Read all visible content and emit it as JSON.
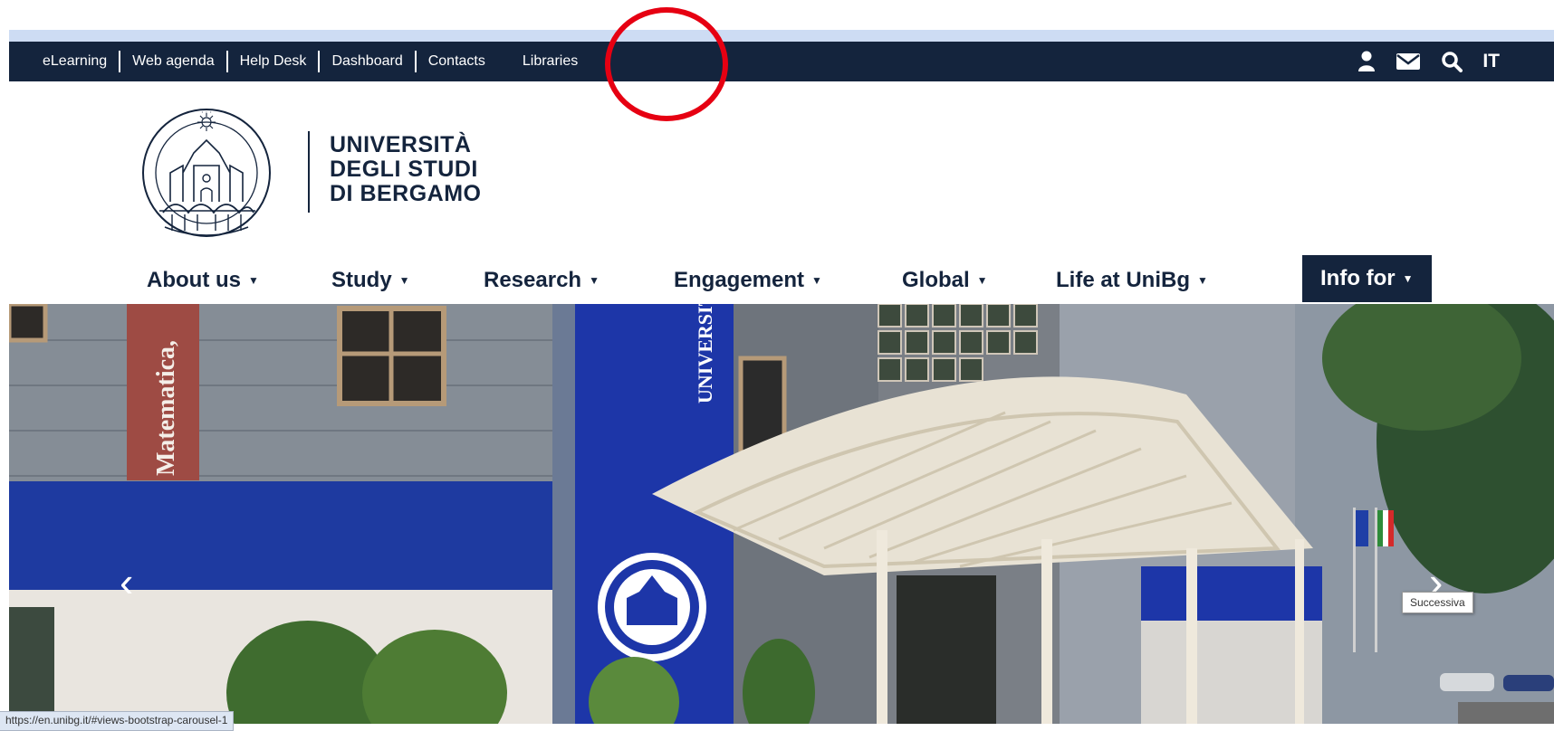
{
  "utility_nav": {
    "links": [
      "eLearning",
      "Web agenda",
      "Help Desk",
      "Dashboard",
      "Contacts",
      "Libraries"
    ],
    "language": "IT",
    "icons": [
      "user-icon",
      "mail-icon",
      "search-icon"
    ]
  },
  "logo": {
    "line1": "UNIVERSITÀ",
    "line2": "DEGLI STUDI",
    "line3": "DI BERGAMO"
  },
  "main_nav": {
    "items": [
      "About us",
      "Study",
      "Research",
      "Engagement",
      "Global",
      "Life at UniBg",
      "Info for"
    ],
    "active_item": "Info for"
  },
  "hero": {
    "prev_glyph": "‹",
    "next_glyph": "›",
    "building_sign_left": "Matematica,",
    "building_sign_tower": "UNIVERSIT"
  },
  "tooltip": "Successiva",
  "status_url": "https://en.unibg.it/#views-bootstrap-carousel-1",
  "colors": {
    "navy": "#14243d",
    "highlight_red": "#e60012",
    "strip_blue": "#cddcf3"
  }
}
